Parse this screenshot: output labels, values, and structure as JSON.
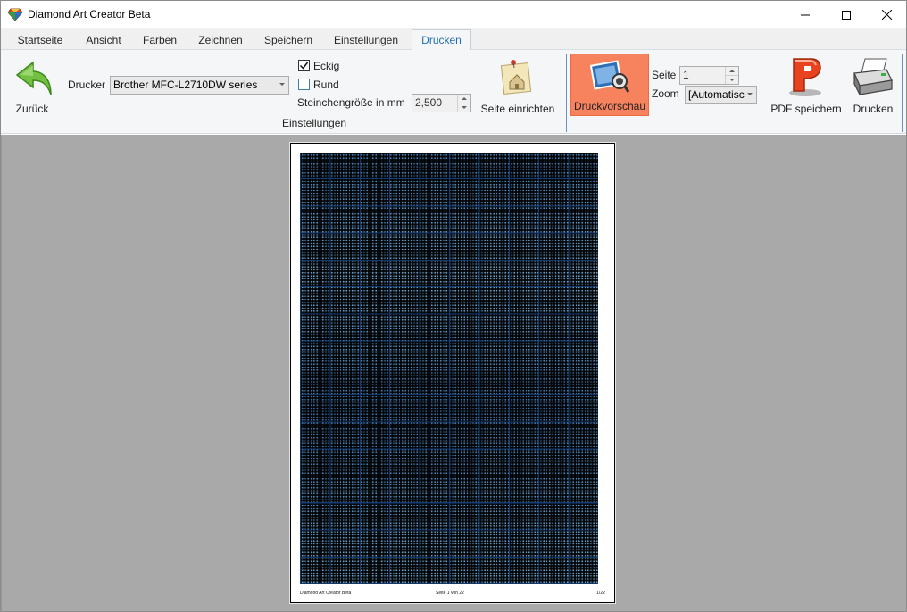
{
  "window": {
    "title": "Diamond Art Creator Beta"
  },
  "tabs": [
    {
      "label": "Startseite"
    },
    {
      "label": "Ansicht"
    },
    {
      "label": "Farben"
    },
    {
      "label": "Zeichnen"
    },
    {
      "label": "Speichern"
    },
    {
      "label": "Einstellungen"
    },
    {
      "label": "Drucken",
      "active": true
    }
  ],
  "ribbon": {
    "back_label": "Zurück",
    "printer_label": "Drucker",
    "printer_value": "Brother MFC-L2710DW series",
    "eckig_label": "Eckig",
    "eckig_checked": true,
    "rund_label": "Rund",
    "rund_checked": false,
    "stone_size_label": "Steinchengröße in mm",
    "stone_size_value": "2,500",
    "group_label": "Einstellungen",
    "page_setup_label": "Seite einrichten",
    "preview_label": "Druckvorschau",
    "page_label": "Seite",
    "page_value": "1",
    "zoom_label": "Zoom",
    "zoom_value": "[Automatisc",
    "pdf_label": "PDF speichern",
    "print_label": "Drucken"
  },
  "preview_page": {
    "footer_left": "Diamond Art Creator Beta",
    "footer_center": "Seite 1 von 22",
    "footer_right": "1/22"
  },
  "colors": {
    "accent_tab": "#1e6fb5",
    "preview_active": "#f6825e",
    "workspace": "#a9a9a9"
  }
}
